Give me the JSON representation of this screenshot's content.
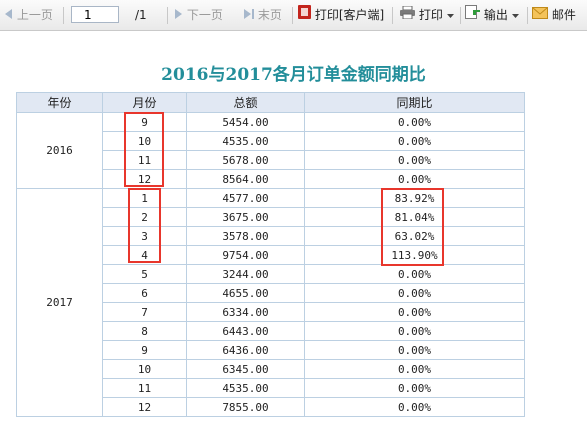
{
  "toolbar": {
    "prev_label": "上一页",
    "page_value": "1",
    "page_total": "/1",
    "next_label": "下一页",
    "last_label": "末页",
    "print_client_label": "打印[客户端]",
    "print_label": "打印",
    "export_label": "输出",
    "mail_label": "邮件"
  },
  "report": {
    "title": "2016与2017各月订单金额同期比",
    "headers": [
      "年份",
      "月份",
      "总额",
      "同期比"
    ],
    "groups": [
      {
        "year": "2016",
        "rows": [
          {
            "month": "9",
            "total": "5454.00",
            "ratio": "0.00%"
          },
          {
            "month": "10",
            "total": "4535.00",
            "ratio": "0.00%"
          },
          {
            "month": "11",
            "total": "5678.00",
            "ratio": "0.00%"
          },
          {
            "month": "12",
            "total": "8564.00",
            "ratio": "0.00%"
          }
        ]
      },
      {
        "year": "2017",
        "rows": [
          {
            "month": "1",
            "total": "4577.00",
            "ratio": "83.92%"
          },
          {
            "month": "2",
            "total": "3675.00",
            "ratio": "81.04%"
          },
          {
            "month": "3",
            "total": "3578.00",
            "ratio": "63.02%"
          },
          {
            "month": "4",
            "total": "9754.00",
            "ratio": "113.90%"
          },
          {
            "month": "5",
            "total": "3244.00",
            "ratio": "0.00%"
          },
          {
            "month": "6",
            "total": "4655.00",
            "ratio": "0.00%"
          },
          {
            "month": "7",
            "total": "6334.00",
            "ratio": "0.00%"
          },
          {
            "month": "8",
            "total": "6443.00",
            "ratio": "0.00%"
          },
          {
            "month": "9",
            "total": "6436.00",
            "ratio": "0.00%"
          },
          {
            "month": "10",
            "total": "6345.00",
            "ratio": "0.00%"
          },
          {
            "month": "11",
            "total": "4535.00",
            "ratio": "0.00%"
          },
          {
            "month": "12",
            "total": "7855.00",
            "ratio": "0.00%"
          }
        ]
      }
    ]
  },
  "colors": {
    "title": "#238e9a",
    "header_bg": "#e1e8f3",
    "grid": "#bcd0e2",
    "highlight_box": "#e8362c"
  }
}
